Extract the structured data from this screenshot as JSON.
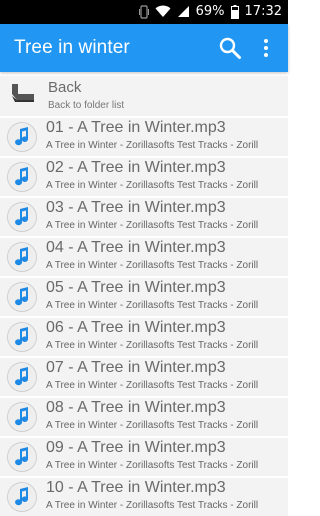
{
  "status_bar": {
    "battery_percent": "69%",
    "time": "17:32",
    "icons": [
      "vibrate-icon",
      "wifi-icon",
      "signal-icon",
      "battery-icon"
    ]
  },
  "app_bar": {
    "title": "Tree in winter",
    "background": "#2196F3",
    "actions": [
      "search-icon",
      "overflow-menu-icon"
    ]
  },
  "back": {
    "label": "Back",
    "sublabel": "Back to folder list"
  },
  "tracks": [
    {
      "title": "01 - A Tree in Winter.mp3",
      "subtitle": "A Tree in Winter - Zorillasofts Test Tracks - Zorill"
    },
    {
      "title": "02 - A Tree in Winter.mp3",
      "subtitle": "A Tree in Winter - Zorillasofts Test Tracks - Zorill"
    },
    {
      "title": "03 - A Tree in Winter.mp3",
      "subtitle": "A Tree in Winter - Zorillasofts Test Tracks - Zorill"
    },
    {
      "title": "04 - A Tree in Winter.mp3",
      "subtitle": "A Tree in Winter - Zorillasofts Test Tracks - Zorill"
    },
    {
      "title": "05 - A Tree in Winter.mp3",
      "subtitle": "A Tree in Winter - Zorillasofts Test Tracks - Zorill"
    },
    {
      "title": "06 - A Tree in Winter.mp3",
      "subtitle": "A Tree in Winter - Zorillasofts Test Tracks - Zorill"
    },
    {
      "title": "07 - A Tree in Winter.mp3",
      "subtitle": "A Tree in Winter - Zorillasofts Test Tracks - Zorill"
    },
    {
      "title": "08 - A Tree in Winter.mp3",
      "subtitle": "A Tree in Winter - Zorillasofts Test Tracks - Zorill"
    },
    {
      "title": "09 - A Tree in Winter.mp3",
      "subtitle": "A Tree in Winter - Zorillasofts Test Tracks - Zorill"
    },
    {
      "title": "10 - A Tree in Winter.mp3",
      "subtitle": "A Tree in Winter - Zorillasofts Test Tracks - Zorill"
    }
  ]
}
